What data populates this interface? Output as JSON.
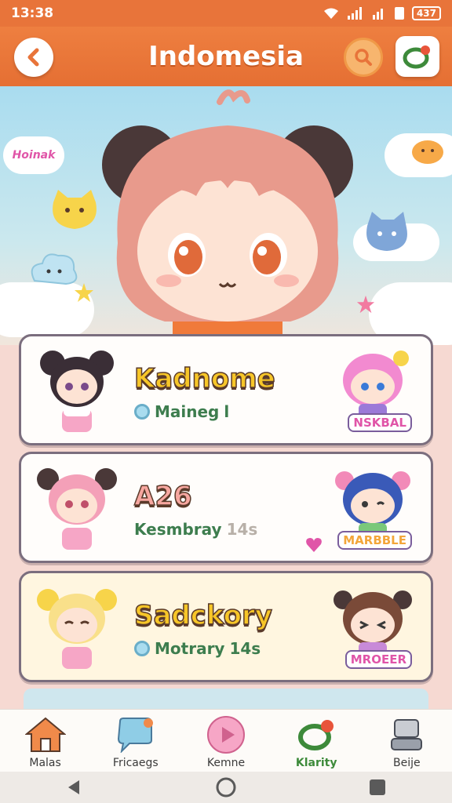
{
  "status": {
    "time": "13:38",
    "battery": "437"
  },
  "header": {
    "title": "Indomesia"
  },
  "hero": {
    "bubble_text": "Hoinak"
  },
  "cards": [
    {
      "name": "Kadnome",
      "subtitle": "Maineg",
      "suffix": "l",
      "sticker": "NSKBAL"
    },
    {
      "name": "A26",
      "subtitle": "Kesmbray",
      "suffix": "14s",
      "sticker": "MARBBLE"
    },
    {
      "name": "Sadckory",
      "subtitle": "Motrary",
      "suffix": "14s",
      "sticker": "MROEER"
    }
  ],
  "nav": [
    {
      "label": "Malas",
      "icon": "house-icon"
    },
    {
      "label": "Fricaegs",
      "icon": "chat-bubble-icon"
    },
    {
      "label": "Kemne",
      "icon": "play-icon"
    },
    {
      "label": "Klarity",
      "icon": "chat-ring-icon"
    },
    {
      "label": "Beije",
      "icon": "device-icon"
    }
  ],
  "colors": {
    "accent": "#e8743a",
    "title_shadow": "#c5561f",
    "card_border": "#7b6e7e",
    "active_nav": "#3d8a3a"
  }
}
